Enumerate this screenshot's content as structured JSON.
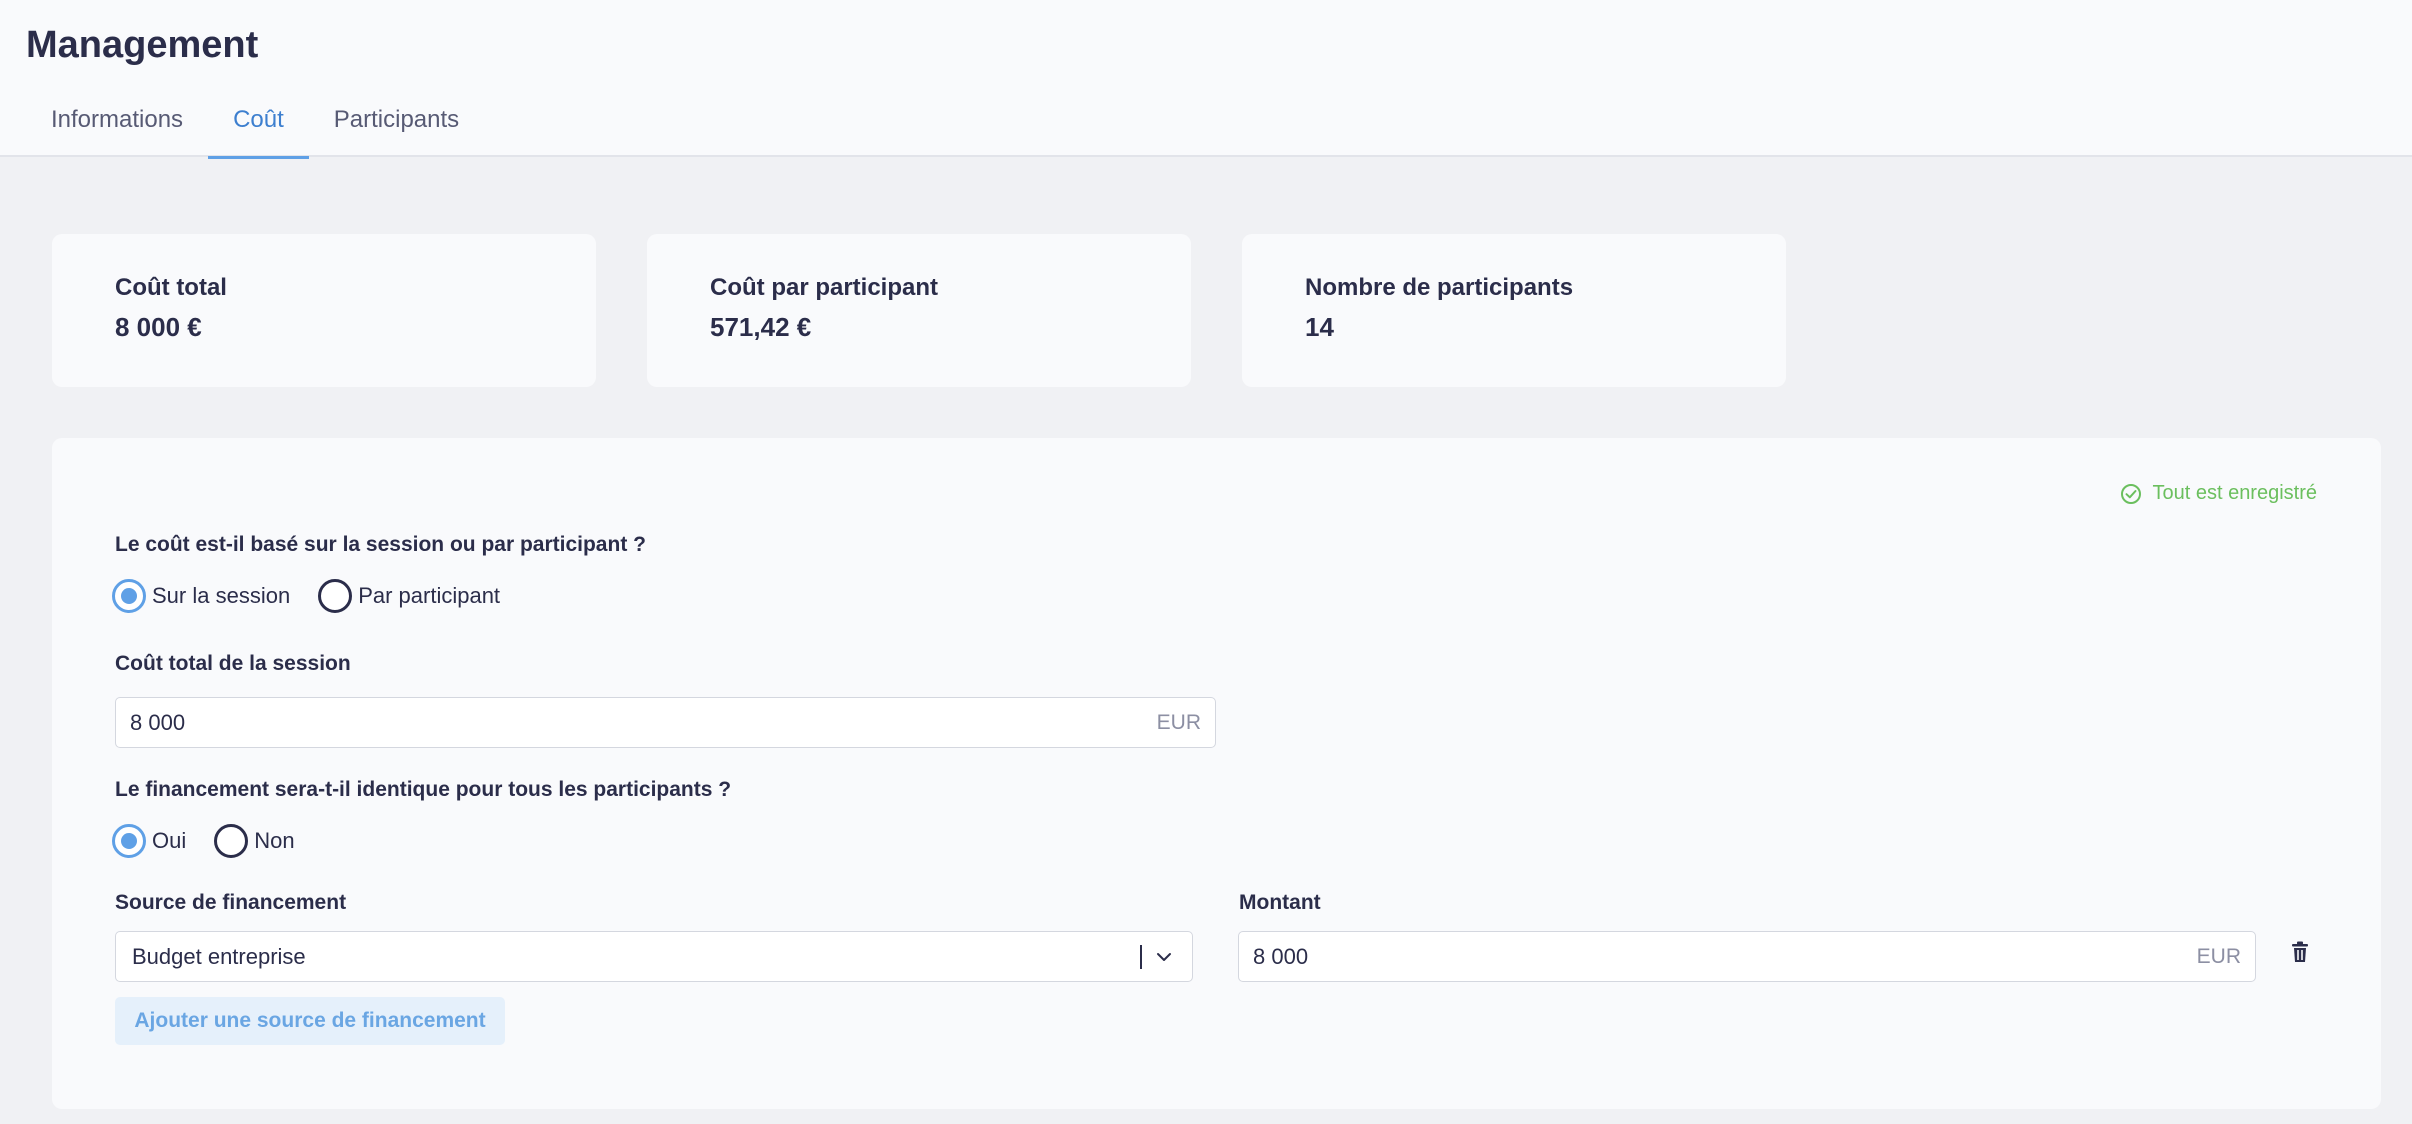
{
  "header": {
    "title": "Management",
    "tabs": [
      {
        "label": "Informations",
        "active": false
      },
      {
        "label": "Coût",
        "active": true
      },
      {
        "label": "Participants",
        "active": false
      }
    ]
  },
  "stats": [
    {
      "label": "Coût total",
      "value": "8 000 €"
    },
    {
      "label": "Coût par participant",
      "value": "571,42 €"
    },
    {
      "label": "Nombre de participants",
      "value": "14"
    }
  ],
  "form": {
    "save_status": "Tout est enregistré",
    "cost_basis": {
      "question": "Le coût est-il basé sur la session ou par participant ?",
      "options": [
        "Sur la session",
        "Par participant"
      ],
      "selected": "Sur la session"
    },
    "session_cost": {
      "label": "Coût total de la session",
      "value": "8 000",
      "currency": "EUR"
    },
    "identical_funding": {
      "question": "Le financement sera-t-il identique pour tous les participants ?",
      "options": [
        "Oui",
        "Non"
      ],
      "selected": "Oui"
    },
    "funding_source": {
      "label": "Source de financement",
      "value": "Budget entreprise"
    },
    "amount": {
      "label": "Montant",
      "value": "8 000",
      "currency": "EUR"
    },
    "add_source_label": "Ajouter une source de financement"
  },
  "colors": {
    "accent": "#5fa0e6",
    "success": "#6bbf5e",
    "text": "#2b2d4a",
    "background": "#f0f1f4",
    "card": "#f9fafc"
  },
  "icons": {
    "saved": "check-circle-icon",
    "select": "chevron-down-icon",
    "delete": "trash-icon"
  }
}
